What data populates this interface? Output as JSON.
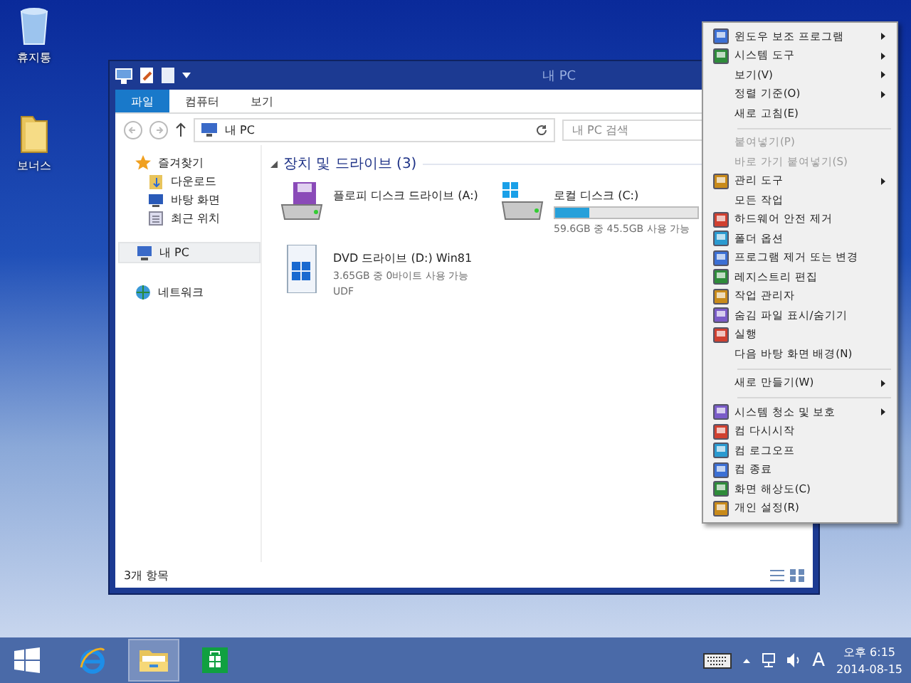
{
  "desktop_icons": [
    {
      "label": "휴지통",
      "kind": "bin"
    },
    {
      "label": "보너스",
      "kind": "folder"
    }
  ],
  "window": {
    "title": "내 PC",
    "ribbon_tabs": [
      {
        "label": "파일",
        "selected": true
      },
      {
        "label": "컴퓨터",
        "selected": false
      },
      {
        "label": "보기",
        "selected": false
      }
    ],
    "address": {
      "path": "내 PC",
      "search_placeholder": "내 PC 검색"
    },
    "nav": [
      {
        "label": "즐겨찾기",
        "kind": "star",
        "selected": false,
        "children": [
          {
            "label": "다운로드",
            "kind": "download",
            "selected": false
          },
          {
            "label": "바탕 화면",
            "kind": "desktop",
            "selected": false
          },
          {
            "label": "최근 위치",
            "kind": "recent",
            "selected": false
          }
        ]
      },
      {
        "label": "내 PC",
        "kind": "pc",
        "selected": true
      },
      {
        "label": "네트워크",
        "kind": "network",
        "selected": false
      }
    ],
    "group": "장치 및 드라이브 (3)",
    "drives": [
      {
        "name": "플로피 디스크 드라이브 (A:)",
        "kind": "floppy"
      },
      {
        "name": "로컬 디스크 (C:)",
        "kind": "disk",
        "level": 0.24,
        "info": "59.6GB 중 45.5GB 사용 가능"
      },
      {
        "name": "DVD 드라이브 (D:) Win81",
        "kind": "dvd",
        "info": "3.65GB 중 0바이트 사용 가능",
        "extra": "UDF"
      }
    ],
    "status": "3개 항목"
  },
  "context_menu": [
    {
      "kind": "tool",
      "label": "윈도우 보조 프로그램",
      "submenu": true,
      "disabled": false
    },
    {
      "kind": "tool",
      "label": "시스템 도구",
      "submenu": true,
      "disabled": false
    },
    {
      "kind": "item",
      "label": "보기(V)",
      "submenu": true,
      "disabled": false
    },
    {
      "kind": "item",
      "label": "정렬 기준(O)",
      "submenu": true,
      "disabled": false
    },
    {
      "kind": "item",
      "label": "새로 고침(E)",
      "submenu": false,
      "disabled": false
    },
    {
      "kind": "separator"
    },
    {
      "kind": "item",
      "label": "붙여넣기(P)",
      "submenu": false,
      "disabled": true
    },
    {
      "kind": "item",
      "label": "바로 가기 붙여넣기(S)",
      "submenu": false,
      "disabled": true
    },
    {
      "kind": "tool",
      "label": "관리 도구",
      "submenu": true,
      "disabled": false
    },
    {
      "kind": "item",
      "label": "모든 작업",
      "submenu": false,
      "disabled": false
    },
    {
      "kind": "tool",
      "label": "하드웨어 안전 제거",
      "submenu": false,
      "disabled": false
    },
    {
      "kind": "tool",
      "label": "폴더 옵션",
      "submenu": false,
      "disabled": false
    },
    {
      "kind": "tool",
      "label": "프로그램 제거 또는 변경",
      "submenu": false,
      "disabled": false
    },
    {
      "kind": "tool",
      "label": "레지스트리 편집",
      "submenu": false,
      "disabled": false
    },
    {
      "kind": "tool",
      "label": "작업 관리자",
      "submenu": false,
      "disabled": false
    },
    {
      "kind": "tool",
      "label": "숨김 파일 표시/숨기기",
      "submenu": false,
      "disabled": false
    },
    {
      "kind": "tool",
      "label": "실행",
      "submenu": false,
      "disabled": false
    },
    {
      "kind": "item",
      "label": "다음 바탕 화면 배경(N)",
      "submenu": false,
      "disabled": false
    },
    {
      "kind": "separator"
    },
    {
      "kind": "item",
      "label": "새로 만들기(W)",
      "submenu": true,
      "disabled": false
    },
    {
      "kind": "separator"
    },
    {
      "kind": "tool",
      "label": "시스템 청소 및 보호",
      "submenu": true,
      "disabled": false
    },
    {
      "kind": "tool",
      "label": "컴 다시시작",
      "submenu": false,
      "disabled": false
    },
    {
      "kind": "tool",
      "label": "컴 로그오프",
      "submenu": false,
      "disabled": false
    },
    {
      "kind": "tool",
      "label": "컴 종료",
      "submenu": false,
      "disabled": false
    },
    {
      "kind": "tool",
      "label": "화면 해상도(C)",
      "submenu": false,
      "disabled": false
    },
    {
      "kind": "tool",
      "label": "개인 설정(R)",
      "submenu": false,
      "disabled": false
    }
  ],
  "taskbar": {
    "apps": [
      {
        "kind": "ie",
        "selected": false
      },
      {
        "kind": "explorer",
        "selected": true
      },
      {
        "kind": "store",
        "selected": false
      }
    ],
    "ime": "A",
    "time": "오후 6:15",
    "date": "2014-08-15"
  }
}
